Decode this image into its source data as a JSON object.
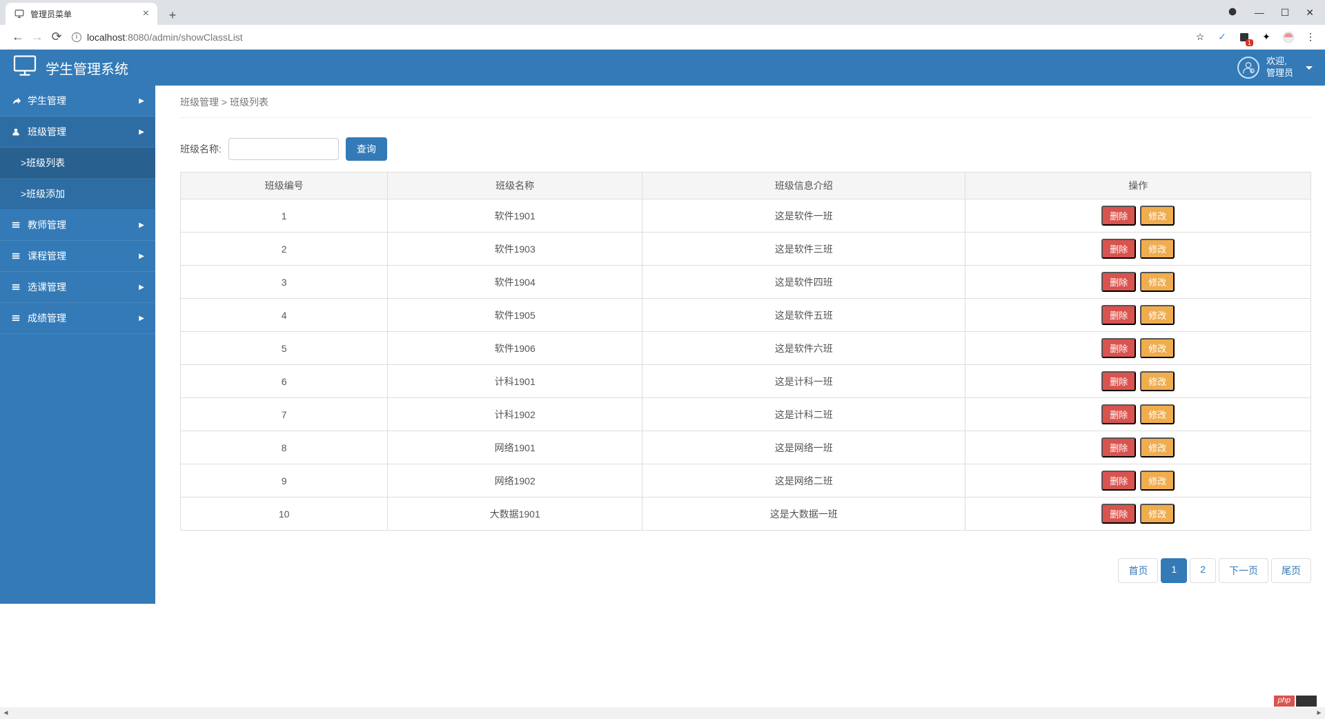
{
  "browser": {
    "tab_title": "管理员菜单",
    "url_host": "localhost",
    "url_port": ":8080",
    "url_path": "/admin/showClassList",
    "ext_badge": "1"
  },
  "header": {
    "app_title": "学生管理系统",
    "welcome": "欢迎,",
    "user_role": "管理员"
  },
  "sidebar": {
    "items": [
      {
        "label": "学生管理",
        "icon": "leaf"
      },
      {
        "label": "班级管理",
        "icon": "user",
        "expanded": true,
        "children": [
          {
            "label": ">班级列表",
            "active": true
          },
          {
            "label": ">班级添加"
          }
        ]
      },
      {
        "label": "教师管理",
        "icon": "list"
      },
      {
        "label": "课程管理",
        "icon": "list"
      },
      {
        "label": "选课管理",
        "icon": "list"
      },
      {
        "label": "成绩管理",
        "icon": "list"
      }
    ]
  },
  "breadcrumb": {
    "parent": "班级管理",
    "separator": ">",
    "current": "班级列表"
  },
  "search": {
    "label": "班级名称:",
    "button": "查询"
  },
  "table": {
    "headers": [
      "班级编号",
      "班级名称",
      "班级信息介绍",
      "操作"
    ],
    "rows": [
      {
        "id": "1",
        "name": "软件1901",
        "desc": "这是软件一班"
      },
      {
        "id": "2",
        "name": "软件1903",
        "desc": "这是软件三班"
      },
      {
        "id": "3",
        "name": "软件1904",
        "desc": "这是软件四班"
      },
      {
        "id": "4",
        "name": "软件1905",
        "desc": "这是软件五班"
      },
      {
        "id": "5",
        "name": "软件1906",
        "desc": "这是软件六班"
      },
      {
        "id": "6",
        "name": "计科1901",
        "desc": "这是计科一班"
      },
      {
        "id": "7",
        "name": "计科1902",
        "desc": "这是计科二班"
      },
      {
        "id": "8",
        "name": "网络1901",
        "desc": "这是网络一班"
      },
      {
        "id": "9",
        "name": "网络1902",
        "desc": "这是网络二班"
      },
      {
        "id": "10",
        "name": "大数据1901",
        "desc": "这是大数据一班"
      }
    ],
    "actions": {
      "delete": "删除",
      "edit": "修改"
    }
  },
  "pagination": {
    "first": "首页",
    "p1": "1",
    "p2": "2",
    "next": "下一页",
    "last": "尾页"
  },
  "footer": {
    "php": "php"
  }
}
